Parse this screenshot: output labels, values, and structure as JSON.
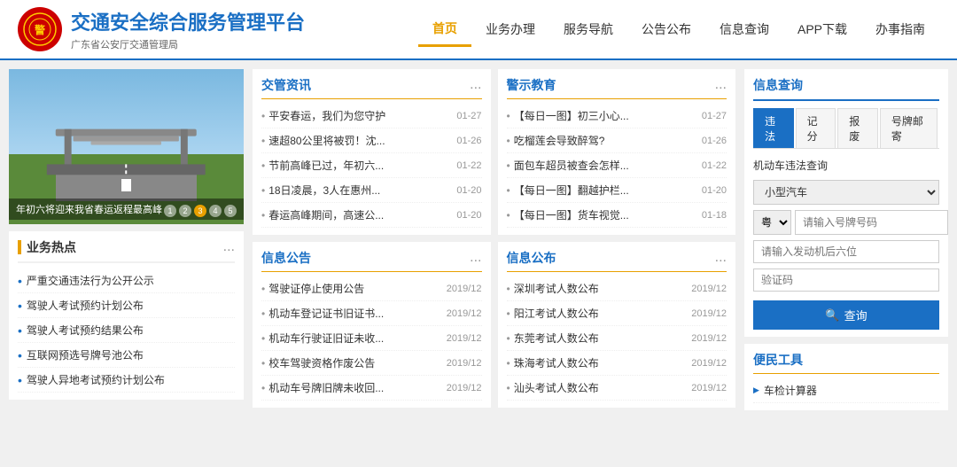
{
  "header": {
    "title": "交通安全综合服务管理平台",
    "subtitle": "广东省公安厅交通管理局",
    "nav": [
      {
        "label": "首页",
        "active": true
      },
      {
        "label": "业务办理",
        "active": false
      },
      {
        "label": "服务导航",
        "active": false
      },
      {
        "label": "公告公布",
        "active": false
      },
      {
        "label": "信息查询",
        "active": false
      },
      {
        "label": "APP下载",
        "active": false
      },
      {
        "label": "办事指南",
        "active": false
      }
    ]
  },
  "banner": {
    "caption": "年初六将迎来我省春运返程最高峰",
    "dots": [
      "1",
      "2",
      "3",
      "4",
      "5"
    ],
    "active_dot": 2
  },
  "business_hot": {
    "title": "业务热点",
    "more": "...",
    "items": [
      "严重交通违法行为公开公示",
      "驾驶人考试预约计划公布",
      "驾驶人考试预约结果公布",
      "互联网预选号牌号池公布",
      "驾驶人异地考试预约计划公布"
    ]
  },
  "traffic_news": {
    "title": "交管资讯",
    "more": "...",
    "items": [
      {
        "title": "平安春运，我们为您守护",
        "date": "01-27"
      },
      {
        "title": "速超80公里将被罚！沈...",
        "date": "01-26"
      },
      {
        "title": "节前高峰已过，年初六...",
        "date": "01-22"
      },
      {
        "title": "18日凌晨，3人在惠州...",
        "date": "01-20"
      },
      {
        "title": "春运高峰期间，高速公...",
        "date": "01-20"
      }
    ]
  },
  "warning_edu": {
    "title": "警示教育",
    "more": "...",
    "items": [
      {
        "title": "【每日一图】初三小心...",
        "date": "01-27"
      },
      {
        "title": "吃榴莲会导致醉驾?",
        "date": "01-26"
      },
      {
        "title": "面包车超员被查会怎样...",
        "date": "01-22"
      },
      {
        "title": "【每日一图】翻越护栏...",
        "date": "01-20"
      },
      {
        "title": "【每日一图】货车视觉...",
        "date": "01-18"
      }
    ]
  },
  "info_notice": {
    "title": "信息公告",
    "more": "...",
    "items": [
      {
        "title": "驾驶证停止使用公告",
        "date": "2019/12"
      },
      {
        "title": "机动车登记证书旧证书...",
        "date": "2019/12"
      },
      {
        "title": "机动车行驶证旧证未收...",
        "date": "2019/12"
      },
      {
        "title": "校车驾驶资格作废公告",
        "date": "2019/12"
      },
      {
        "title": "机动车号牌旧牌未收回...",
        "date": "2019/12"
      }
    ]
  },
  "info_bulletin": {
    "title": "信息公布",
    "more": "...",
    "items": [
      {
        "title": "深圳考试人数公布",
        "date": "2019/12"
      },
      {
        "title": "阳江考试人数公布",
        "date": "2019/12"
      },
      {
        "title": "东莞考试人数公布",
        "date": "2019/12"
      },
      {
        "title": "珠海考试人数公布",
        "date": "2019/12"
      },
      {
        "title": "汕头考试人数公布",
        "date": "2019/12"
      }
    ]
  },
  "info_query": {
    "title": "信息查询",
    "tabs": [
      "违法",
      "记分",
      "报废",
      "号牌邮寄"
    ],
    "active_tab": 0,
    "query_title": "机动车违法查询",
    "vehicle_type_label": "小型汽车",
    "plate_prefix": "粤",
    "plate_placeholder": "请输入号牌号码",
    "engine_placeholder": "请输入发动机后六位",
    "captcha_placeholder": "验证码",
    "query_btn": "查询",
    "search_icon": "🔍"
  },
  "convenient_tools": {
    "title": "便民工具",
    "items": [
      "车检计算器"
    ]
  }
}
